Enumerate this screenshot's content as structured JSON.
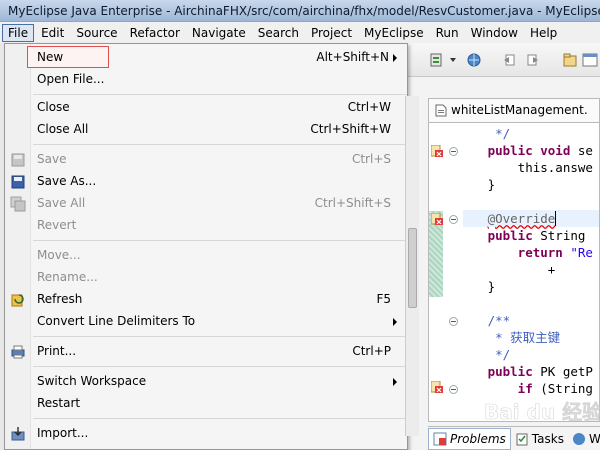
{
  "window": {
    "title": "MyEclipse Java Enterprise - AirchinaFHX/src/com/airchina/fhx/model/ResvCustomer.java - MyEclipse"
  },
  "menubar": {
    "items": [
      "File",
      "Edit",
      "Source",
      "Refactor",
      "Navigate",
      "Search",
      "Project",
      "MyEclipse",
      "Run",
      "Window",
      "Help"
    ],
    "active": "File"
  },
  "file_menu": {
    "items": [
      {
        "label": "New",
        "accel": "Alt+Shift+N",
        "submenu": true,
        "disabled": false,
        "highlighted": true
      },
      {
        "label": "Open File...",
        "accel": "",
        "submenu": false,
        "disabled": false
      },
      {
        "label": "Close",
        "accel": "Ctrl+W",
        "submenu": false,
        "disabled": false
      },
      {
        "label": "Close All",
        "accel": "Ctrl+Shift+W",
        "submenu": false,
        "disabled": false
      },
      {
        "label": "Save",
        "accel": "Ctrl+S",
        "submenu": false,
        "disabled": true,
        "icon": "save-icon"
      },
      {
        "label": "Save As...",
        "accel": "",
        "submenu": false,
        "disabled": false,
        "icon": "save-as-icon"
      },
      {
        "label": "Save All",
        "accel": "Ctrl+Shift+S",
        "submenu": false,
        "disabled": true,
        "icon": "save-all-icon"
      },
      {
        "label": "Revert",
        "accel": "",
        "submenu": false,
        "disabled": true
      },
      {
        "label": "Move...",
        "accel": "",
        "submenu": false,
        "disabled": true
      },
      {
        "label": "Rename...",
        "accel": "",
        "submenu": false,
        "disabled": true
      },
      {
        "label": "Refresh",
        "accel": "F5",
        "submenu": false,
        "disabled": false,
        "icon": "refresh-icon"
      },
      {
        "label": "Convert Line Delimiters To",
        "accel": "",
        "submenu": true,
        "disabled": false
      },
      {
        "label": "Print...",
        "accel": "Ctrl+P",
        "submenu": false,
        "disabled": false,
        "icon": "print-icon"
      },
      {
        "label": "Switch Workspace",
        "accel": "",
        "submenu": true,
        "disabled": false
      },
      {
        "label": "Restart",
        "accel": "",
        "submenu": false,
        "disabled": false
      },
      {
        "label": "Import...",
        "accel": "",
        "submenu": false,
        "disabled": false,
        "icon": "import-icon"
      }
    ]
  },
  "editor": {
    "tab_label": "whiteListManagement.",
    "code_lines": [
      "    */",
      "   public void se",
      "       this.answe",
      "   }",
      "",
      "   @Override",
      "   public String ",
      "       return \"Re",
      "           + ",
      "   }",
      "",
      "   /**",
      "    * 获取主键",
      "    */",
      "   public PK getP",
      "       if (String"
    ]
  },
  "bottom_panel": {
    "tabs": [
      "Problems",
      "Tasks",
      "W"
    ]
  },
  "watermark": {
    "text": "Bai du 经验"
  },
  "colors": {
    "keyword": "#7f0055",
    "string": "#2a00ff",
    "comment": "#3f5fbf",
    "menu_highlight_border": "#e05050",
    "title_bar": "#9db6d7"
  }
}
